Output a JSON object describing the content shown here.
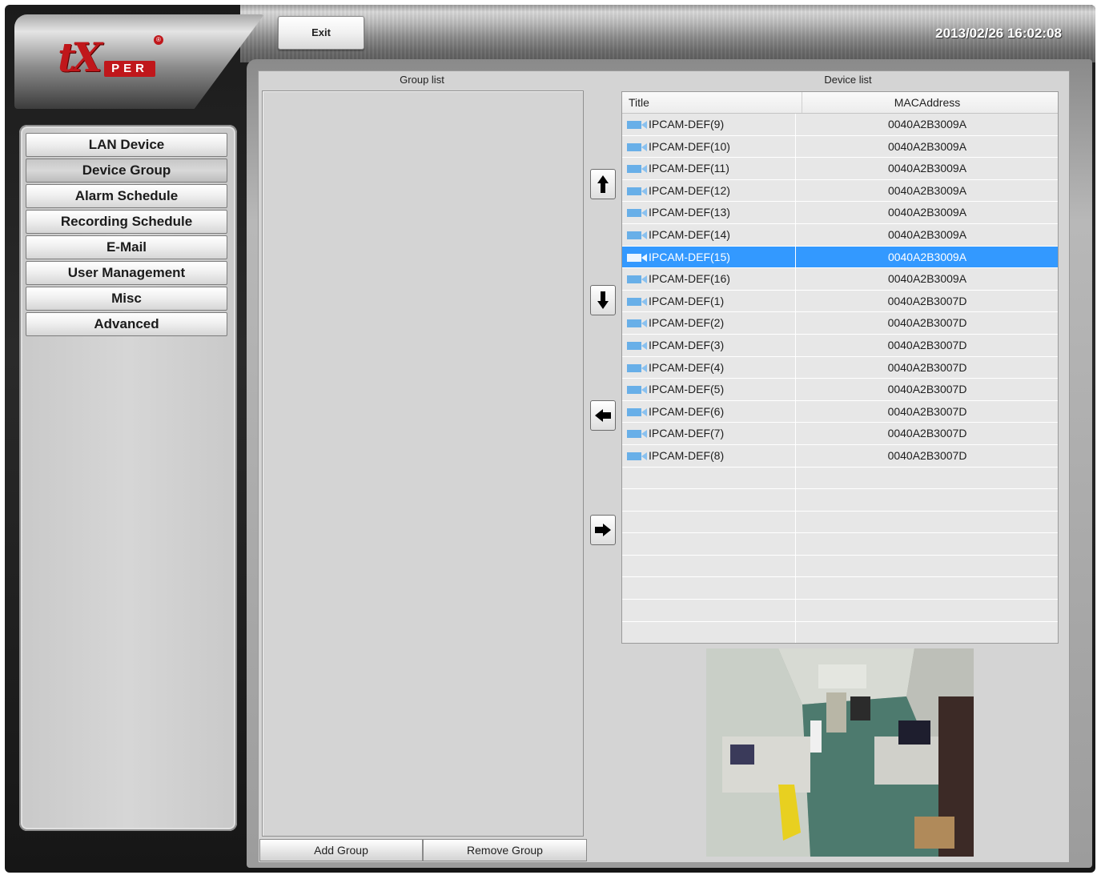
{
  "header": {
    "exit_label": "Exit",
    "datetime": "2013/02/26 16:02:08"
  },
  "logo": {
    "text_main": "tX",
    "text_per": "PER",
    "registered_mark": "®"
  },
  "sidebar": {
    "items": [
      {
        "label": "LAN Device",
        "active": false
      },
      {
        "label": "Device Group",
        "active": true
      },
      {
        "label": "Alarm Schedule",
        "active": false
      },
      {
        "label": "Recording Schedule",
        "active": false
      },
      {
        "label": "E-Mail",
        "active": false
      },
      {
        "label": "User Management",
        "active": false
      },
      {
        "label": "Misc",
        "active": false
      },
      {
        "label": "Advanced",
        "active": false
      }
    ]
  },
  "group_panel": {
    "title": "Group list",
    "add_label": "Add Group",
    "remove_label": "Remove Group"
  },
  "device_panel": {
    "title": "Device list",
    "columns": [
      "Title",
      "MACAddress"
    ],
    "rows": [
      {
        "title": "IPCAM-DEF(9)",
        "mac": "0040A2B3009A",
        "selected": false
      },
      {
        "title": "IPCAM-DEF(10)",
        "mac": "0040A2B3009A",
        "selected": false
      },
      {
        "title": "IPCAM-DEF(11)",
        "mac": "0040A2B3009A",
        "selected": false
      },
      {
        "title": "IPCAM-DEF(12)",
        "mac": "0040A2B3009A",
        "selected": false
      },
      {
        "title": "IPCAM-DEF(13)",
        "mac": "0040A2B3009A",
        "selected": false
      },
      {
        "title": "IPCAM-DEF(14)",
        "mac": "0040A2B3009A",
        "selected": false
      },
      {
        "title": "IPCAM-DEF(15)",
        "mac": "0040A2B3009A",
        "selected": true
      },
      {
        "title": "IPCAM-DEF(16)",
        "mac": "0040A2B3009A",
        "selected": false
      },
      {
        "title": "IPCAM-DEF(1)",
        "mac": "0040A2B3007D",
        "selected": false
      },
      {
        "title": "IPCAM-DEF(2)",
        "mac": "0040A2B3007D",
        "selected": false
      },
      {
        "title": "IPCAM-DEF(3)",
        "mac": "0040A2B3007D",
        "selected": false
      },
      {
        "title": "IPCAM-DEF(4)",
        "mac": "0040A2B3007D",
        "selected": false
      },
      {
        "title": "IPCAM-DEF(5)",
        "mac": "0040A2B3007D",
        "selected": false
      },
      {
        "title": "IPCAM-DEF(6)",
        "mac": "0040A2B3007D",
        "selected": false
      },
      {
        "title": "IPCAM-DEF(7)",
        "mac": "0040A2B3007D",
        "selected": false
      },
      {
        "title": "IPCAM-DEF(8)",
        "mac": "0040A2B3007D",
        "selected": false
      }
    ],
    "empty_rows": 9
  },
  "arrows": [
    {
      "name": "move-up-icon",
      "glyph": "⬆"
    },
    {
      "name": "move-down-icon",
      "glyph": "⬇"
    },
    {
      "name": "move-left-icon",
      "glyph": "⬅"
    },
    {
      "name": "move-right-icon",
      "glyph": "➡"
    }
  ],
  "colors": {
    "selection": "#3399ff",
    "brand_red": "#c0171b",
    "panel_bg": "#d4d4d4"
  },
  "preview": {
    "description_icon": "camera-preview-image"
  }
}
